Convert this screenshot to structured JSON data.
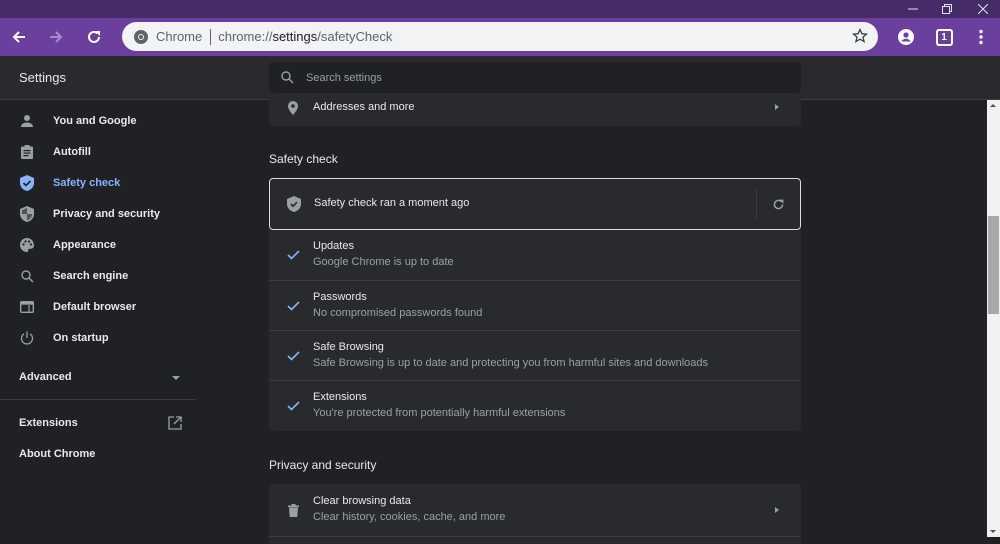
{
  "window": {
    "controls": [
      "minimize",
      "restore",
      "close"
    ]
  },
  "toolbar": {
    "site_chip": "Chrome",
    "url_prefix": "chrome://",
    "url_host": "settings",
    "url_path": "/safetyCheck",
    "tab_count": "1"
  },
  "header": {
    "title": "Settings",
    "search_placeholder": "Search settings"
  },
  "sidebar": {
    "items": [
      {
        "label": "You and Google",
        "icon": "person-icon"
      },
      {
        "label": "Autofill",
        "icon": "clipboard-icon"
      },
      {
        "label": "Safety check",
        "icon": "shield-check-icon",
        "active": true
      },
      {
        "label": "Privacy and security",
        "icon": "shield-icon"
      },
      {
        "label": "Appearance",
        "icon": "palette-icon"
      },
      {
        "label": "Search engine",
        "icon": "search-icon"
      },
      {
        "label": "Default browser",
        "icon": "browser-icon"
      },
      {
        "label": "On startup",
        "icon": "power-icon"
      }
    ],
    "advanced_label": "Advanced",
    "extensions_label": "Extensions",
    "about_label": "About Chrome"
  },
  "main": {
    "autofill_row": {
      "title": "Addresses and more"
    },
    "safety_check": {
      "section_title": "Safety check",
      "status": "Safety check ran a moment ago",
      "items": [
        {
          "title": "Updates",
          "subtitle": "Google Chrome is up to date"
        },
        {
          "title": "Passwords",
          "subtitle": "No compromised passwords found"
        },
        {
          "title": "Safe Browsing",
          "subtitle": "Safe Browsing is up to date and protecting you from harmful sites and downloads"
        },
        {
          "title": "Extensions",
          "subtitle": "You're protected from potentially harmful extensions"
        }
      ]
    },
    "privacy": {
      "section_title": "Privacy and security",
      "items": [
        {
          "title": "Clear browsing data",
          "subtitle": "Clear history, cookies, cache, and more"
        }
      ]
    }
  },
  "colors": {
    "titlebar": "#452c68",
    "toolbar": "#6a3f9e",
    "accent": "#8ab4f8",
    "background": "#202124",
    "card": "#292a2d"
  }
}
